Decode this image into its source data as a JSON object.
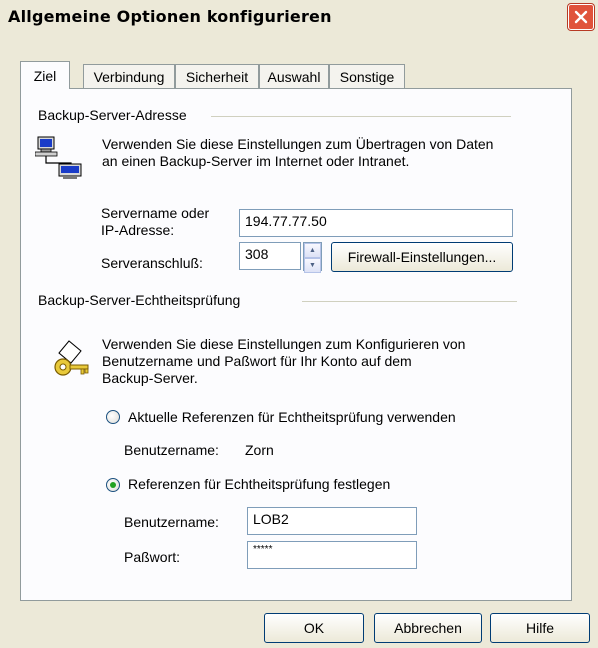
{
  "window": {
    "title": "Allgemeine Optionen konfigurieren"
  },
  "tabs": [
    {
      "label": "Ziel",
      "active": true
    },
    {
      "label": "Verbindung"
    },
    {
      "label": "Sicherheit"
    },
    {
      "label": "Auswahl"
    },
    {
      "label": "Sonstige"
    }
  ],
  "server": {
    "group_label": "Backup-Server-Adresse",
    "description_line1": "Verwenden Sie diese Einstellungen zum Übertragen von Daten",
    "description_line2": "an einen Backup-Server im Internet oder Intranet.",
    "name_label_line1": "Servername oder",
    "name_label_line2": "IP-Adresse:",
    "name_value": "194.77.77.50",
    "port_label": "Serveranschluß:",
    "port_value": "308",
    "firewall_button": "Firewall-Einstellungen..."
  },
  "auth": {
    "group_label": "Backup-Server-Echtheitsprüfung",
    "description_line1": "Verwenden Sie diese Einstellungen zum Konfigurieren von",
    "description_line2": "Benutzername und Paßwort für Ihr Konto auf dem",
    "description_line3": "Backup-Server.",
    "option_current": "Aktuelle Referenzen für Echtheitsprüfung verwenden",
    "current_user_label": "Benutzername:",
    "current_user_value": "Zorn",
    "option_set": "Referenzen für Echtheitsprüfung festlegen",
    "user_label": "Benutzername:",
    "user_value": "LOB2",
    "password_label": "Paßwort:",
    "password_value": "*****",
    "selected_option": "set"
  },
  "buttons": {
    "ok": "OK",
    "cancel": "Abbrechen",
    "help": "Hilfe"
  }
}
